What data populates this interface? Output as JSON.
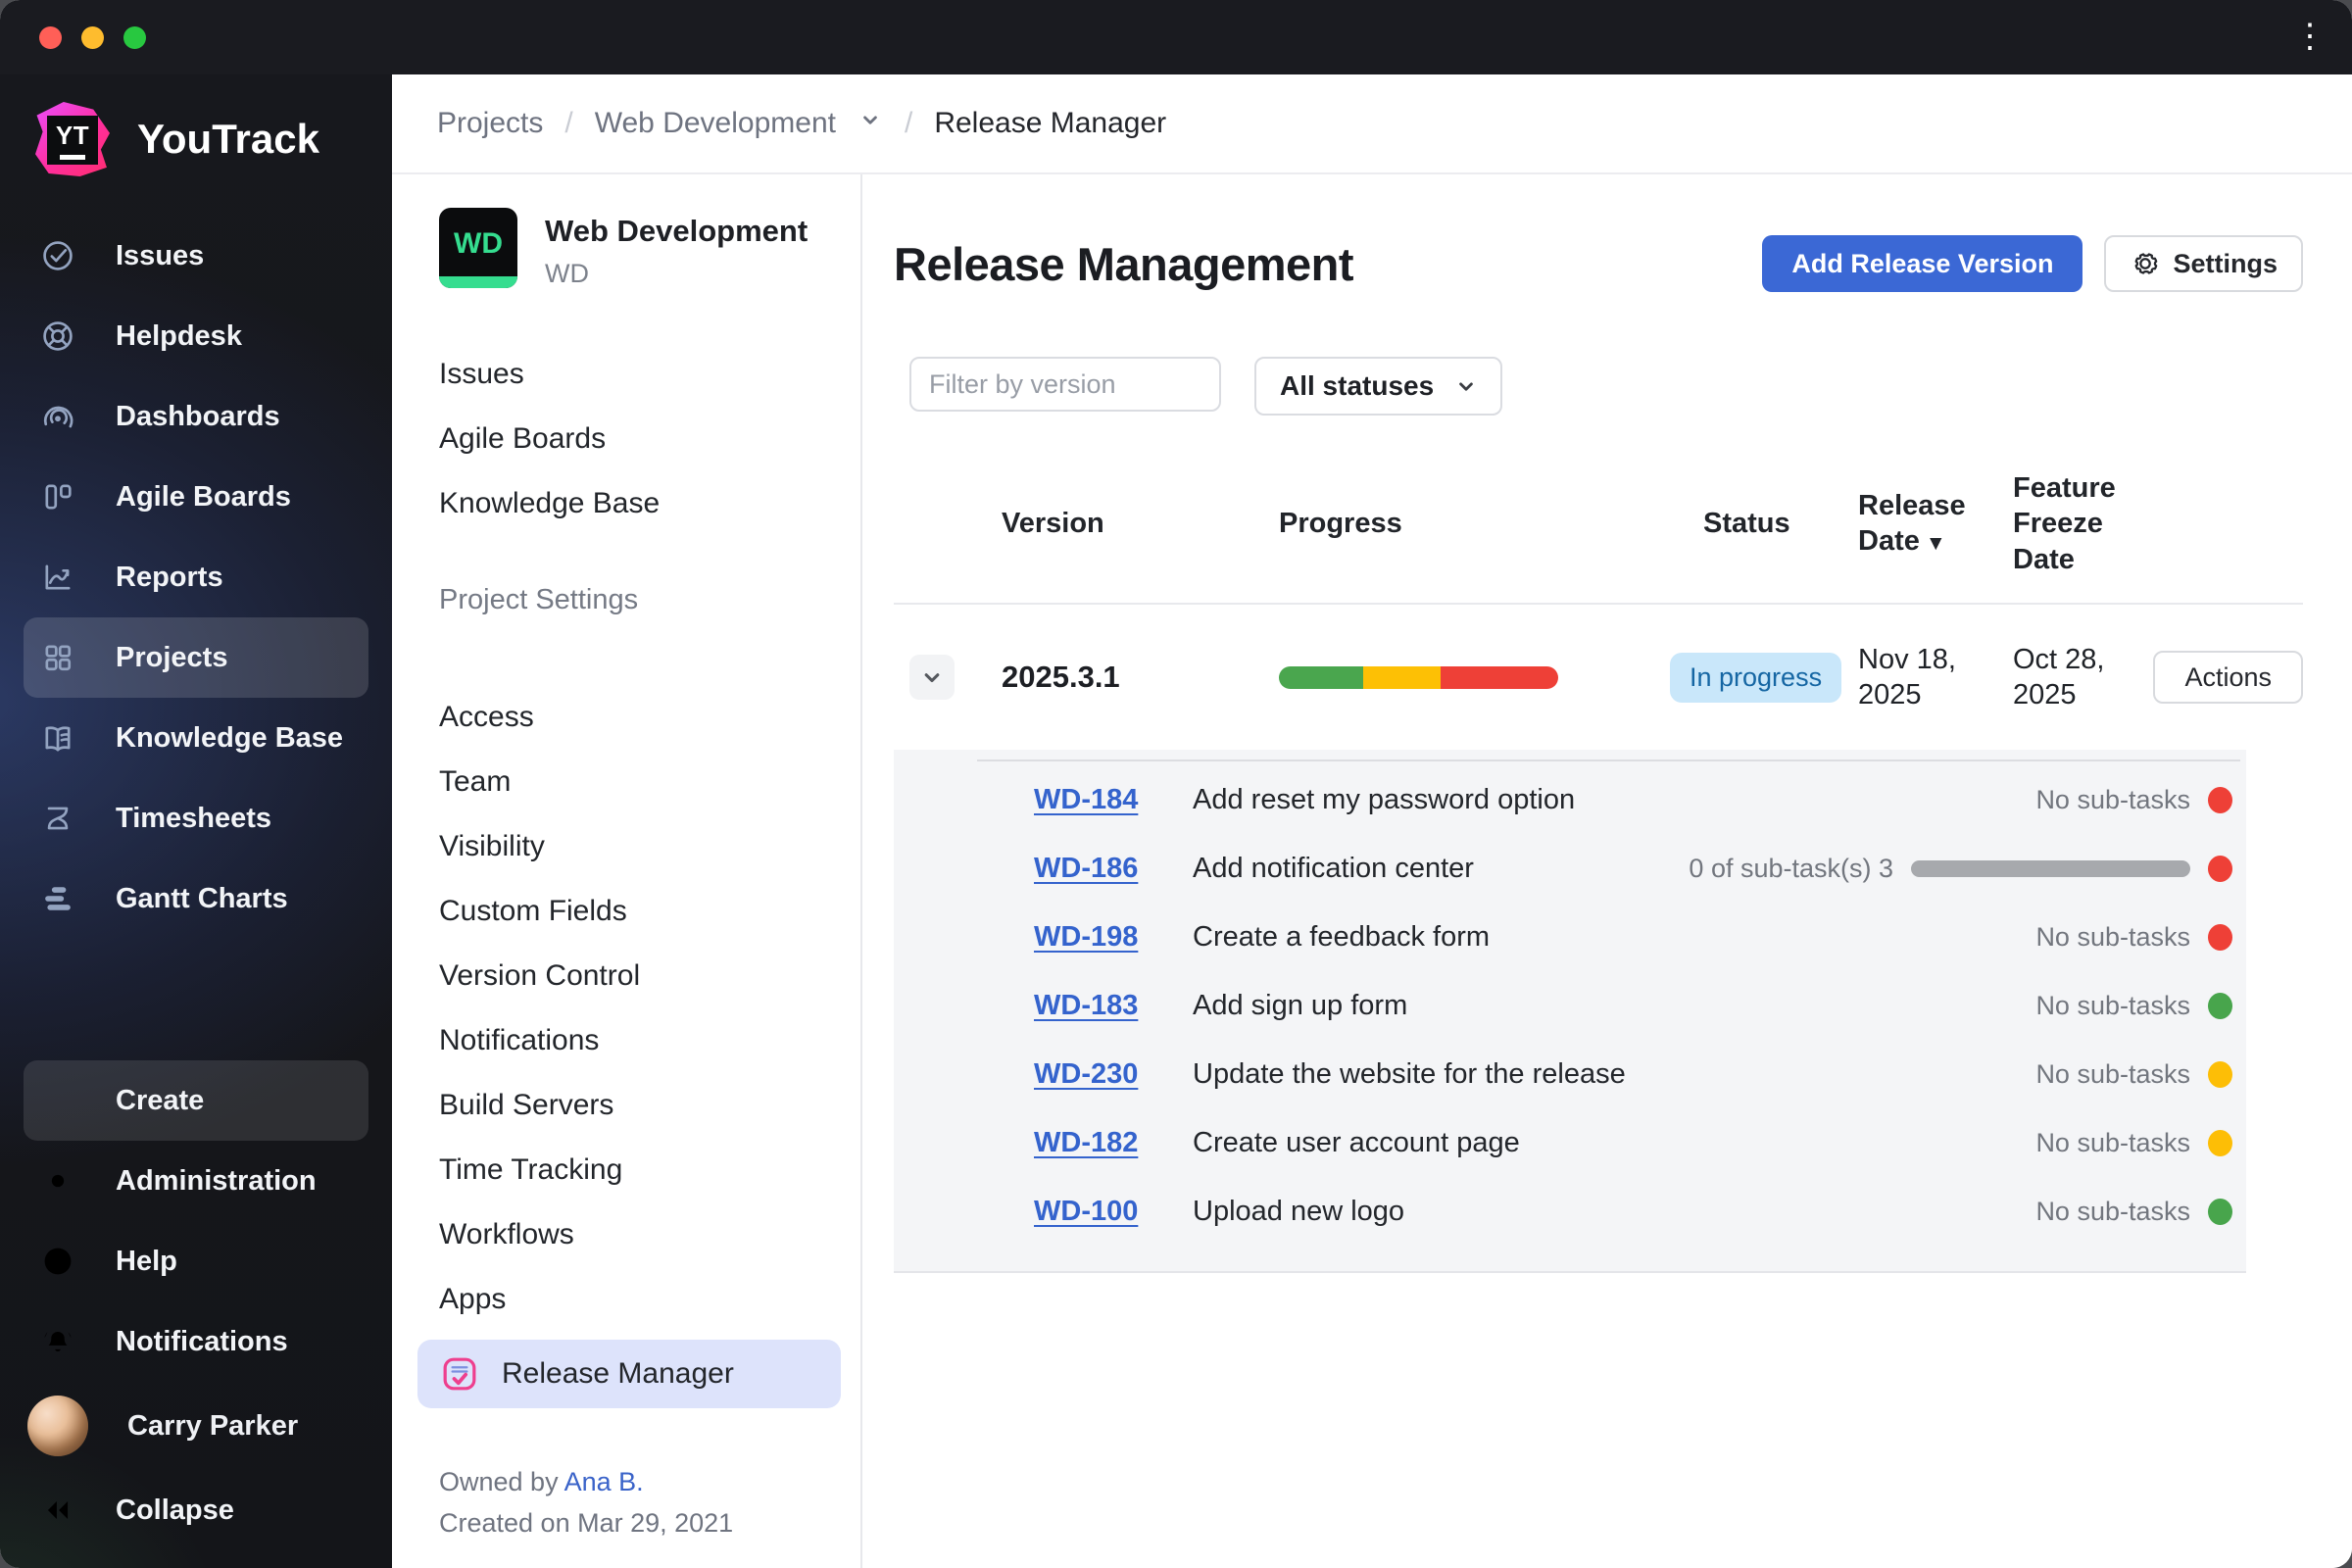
{
  "sidebar": {
    "logo_badge": "YT",
    "logo_text": "YouTrack",
    "items": [
      {
        "label": "Issues"
      },
      {
        "label": "Helpdesk"
      },
      {
        "label": "Dashboards"
      },
      {
        "label": "Agile Boards"
      },
      {
        "label": "Reports"
      },
      {
        "label": "Projects",
        "selected": true
      },
      {
        "label": "Knowledge Base"
      },
      {
        "label": "Timesheets"
      },
      {
        "label": "Gantt Charts"
      }
    ],
    "create_label": "Create",
    "footer_items": [
      {
        "label": "Administration"
      },
      {
        "label": "Help"
      },
      {
        "label": "Notifications"
      }
    ],
    "user_name": "Carry Parker",
    "collapse_label": "Collapse"
  },
  "breadcrumb": {
    "items": [
      "Projects",
      "Web Development",
      "Release Manager"
    ],
    "separator": "/"
  },
  "project_panel": {
    "avatar_text": "WD",
    "name": "Web Development",
    "key": "WD",
    "links": [
      "Issues",
      "Agile Boards",
      "Knowledge Base"
    ],
    "settings_header": "Project Settings",
    "settings_links": [
      "Access",
      "Team",
      "Visibility",
      "Custom Fields",
      "Version Control",
      "Notifications",
      "Build Servers",
      "Time Tracking",
      "Workflows",
      "Apps"
    ],
    "app_link": "Release Manager",
    "owned_by_prefix": "Owned by",
    "owner": "Ana B.",
    "created": "Created on Mar 29, 2021"
  },
  "main": {
    "title": "Release Management",
    "add_button": "Add Release Version",
    "settings_button": "Settings",
    "filter_placeholder": "Filter by version",
    "status_filter_value": "All statuses",
    "table": {
      "headers": [
        "Version",
        "Progress",
        "Status",
        "Release Date",
        "Feature Freeze Date"
      ],
      "sort_indicator": "▼",
      "release": {
        "version": "2025.3.1",
        "progress_pct": {
          "green": 30,
          "yellow": 28,
          "red": 42
        },
        "status": "In progress",
        "release_date": "Nov 18, 2025",
        "freeze_date": "Oct 28, 2025",
        "actions_label": "Actions"
      },
      "issues": [
        {
          "id": "WD-184",
          "title": "Add reset my password option",
          "subtasks": "No sub-tasks",
          "dot_color": "red"
        },
        {
          "id": "WD-186",
          "title": "Add notification center",
          "subtasks": "0 of sub-task(s) 3",
          "has_bar": true,
          "dot_color": "red"
        },
        {
          "id": "WD-198",
          "title": "Create a feedback form",
          "subtasks": "No sub-tasks",
          "dot_color": "red"
        },
        {
          "id": "WD-183",
          "title": "Add sign up form",
          "subtasks": "No sub-tasks",
          "dot_color": "green"
        },
        {
          "id": "WD-230",
          "title": "Update the website for the release",
          "subtasks": "No sub-tasks",
          "dot_color": "yellow"
        },
        {
          "id": "WD-182",
          "title": "Create user account page",
          "subtasks": "No sub-tasks",
          "dot_color": "yellow"
        },
        {
          "id": "WD-100",
          "title": "Upload new logo",
          "subtasks": "No sub-tasks",
          "dot_color": "green"
        }
      ]
    }
  },
  "colors": {
    "accent_blue": "#3b68d5",
    "badge_bg": "#c9e7fa",
    "badge_text": "#1566a3",
    "dot_red": "#ee4037",
    "dot_green": "#48a54c",
    "dot_yellow": "#fdbe06",
    "project_green": "#35dd8f",
    "brand_pink": "#ff2e9d"
  }
}
